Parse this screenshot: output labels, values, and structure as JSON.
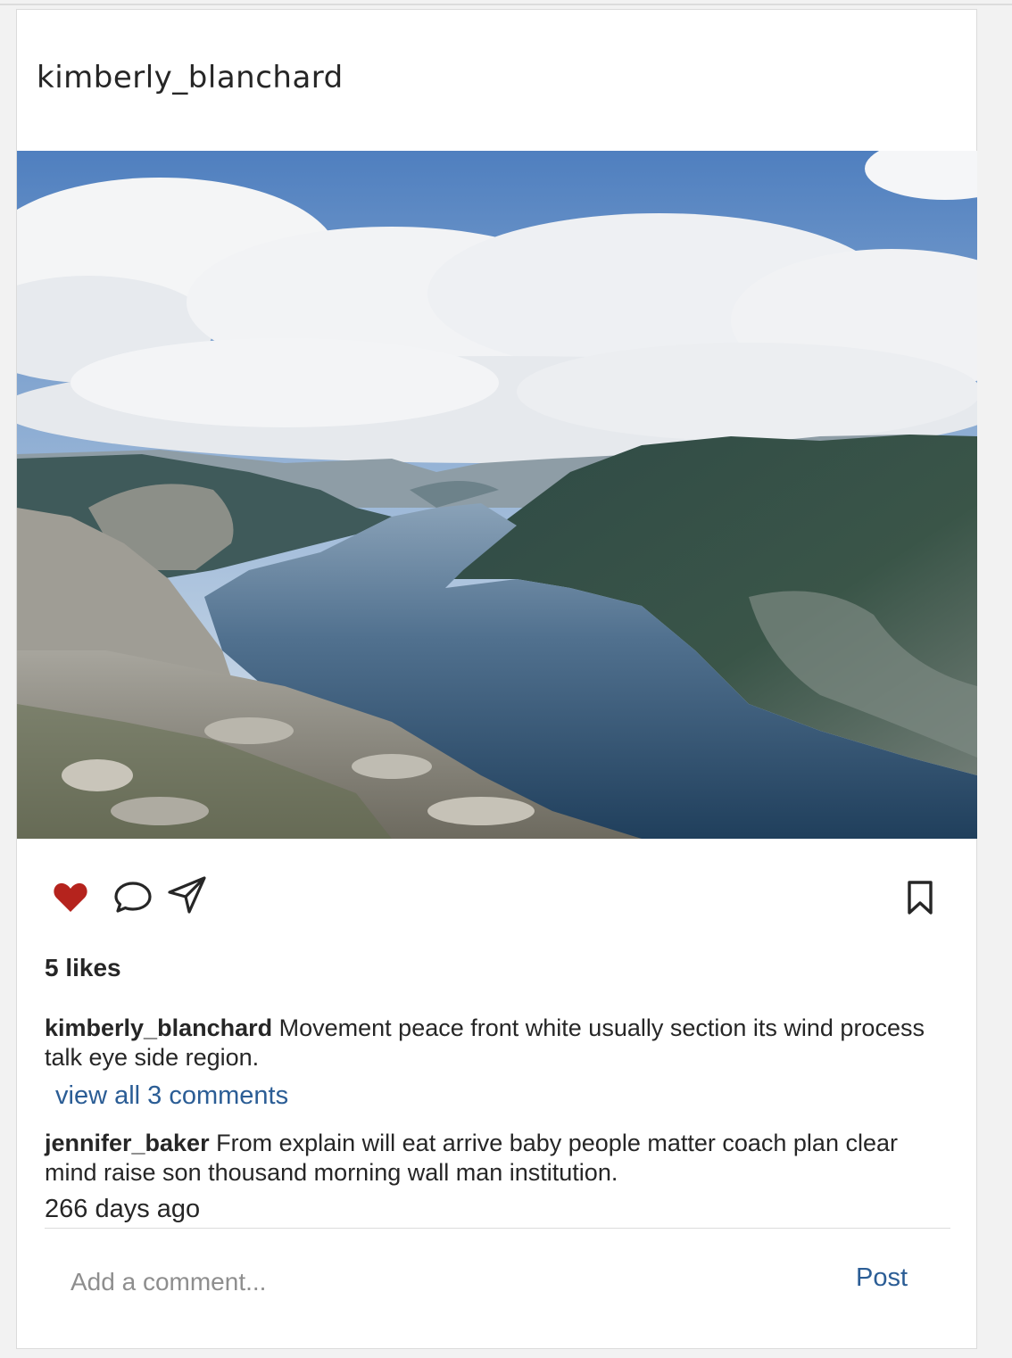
{
  "post": {
    "author": "kimberly_blanchard",
    "liked": true,
    "colors": {
      "heart": "#b5231d",
      "link": "#2b5d95",
      "text": "#262626",
      "placeholder": "#8e8e8e"
    },
    "icons": [
      "heart-icon",
      "comment-icon",
      "share-icon",
      "bookmark-icon"
    ],
    "likes_text": "5 likes",
    "caption": {
      "user": "kimberly_blanchard",
      "text": "Movement peace front white usually section its wind process talk eye side region."
    },
    "view_all_text": "view all 3 comments",
    "comments": [
      {
        "user": "jennifer_baker",
        "text": "From explain will eat arrive baby people matter coach plan clear mind raise son thousand morning wall man institution."
      }
    ],
    "timestamp": "266 days ago",
    "add_comment": {
      "placeholder": "Add a comment...",
      "post_label": "Post"
    }
  }
}
